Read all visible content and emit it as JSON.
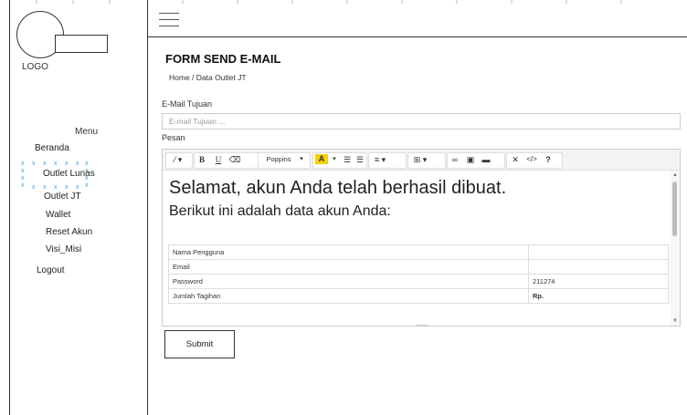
{
  "sidebar": {
    "logo_label": "LOGO",
    "menu_title": "Menu",
    "items": [
      {
        "label": "Beranda"
      },
      {
        "label": "Outlet Lunas"
      },
      {
        "label": "Outlet JT"
      },
      {
        "label": "Wallet"
      },
      {
        "label": "Reset Akun"
      },
      {
        "label": "Visi_Misi"
      },
      {
        "label": "Logout"
      }
    ]
  },
  "main": {
    "title": "FORM SEND E-MAIL",
    "breadcrumb": "Home / Data Outlet JT",
    "email_label": "E-Mail Tujuan",
    "email_placeholder": "E-mail Tujuan ...",
    "email_value": "",
    "message_label": "Pesan",
    "submit_label": "Submit"
  },
  "editor": {
    "font_name": "Poppins",
    "heading": "Selamat, akun Anda telah berhasil dibuat.",
    "subheading": "Berikut ini adalah data akun Anda:",
    "table": [
      {
        "label": "Nama Pengguna",
        "value": ""
      },
      {
        "label": "Email",
        "value": ""
      },
      {
        "label": "Password",
        "value": "211274"
      },
      {
        "label": "Jumlah Tagihan",
        "value": "Rp."
      }
    ]
  },
  "colors": {
    "selection_marker": "#44a0d8",
    "highlight_swatch": "#f5d000"
  }
}
